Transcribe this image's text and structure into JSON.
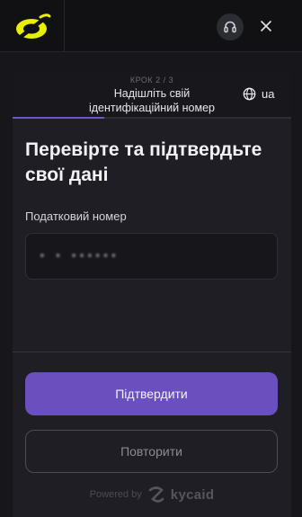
{
  "colors": {
    "background": "#16161b",
    "panel": "#1e1e24",
    "accent": "#6a4fbe",
    "logo": "#e6f000"
  },
  "header": {
    "logo_icon": "brand-logo-icon",
    "support_icon": "headset-icon",
    "close_icon": "close-icon"
  },
  "step": {
    "counter": "КРОК 2 / 3",
    "title": "Надішліть свій ідентифікаційний номер",
    "progress": 0.33
  },
  "language": {
    "icon": "globe-icon",
    "code": "ua"
  },
  "form": {
    "heading": "Перевірте та підтвердьте свої дані",
    "tax_field": {
      "label": "Податковий номер",
      "value": "• • ••••••"
    }
  },
  "actions": {
    "confirm_label": "Підтвердити",
    "retry_label": "Повторити"
  },
  "footer": {
    "powered_by": "Powered by",
    "brand": "kycaid"
  }
}
